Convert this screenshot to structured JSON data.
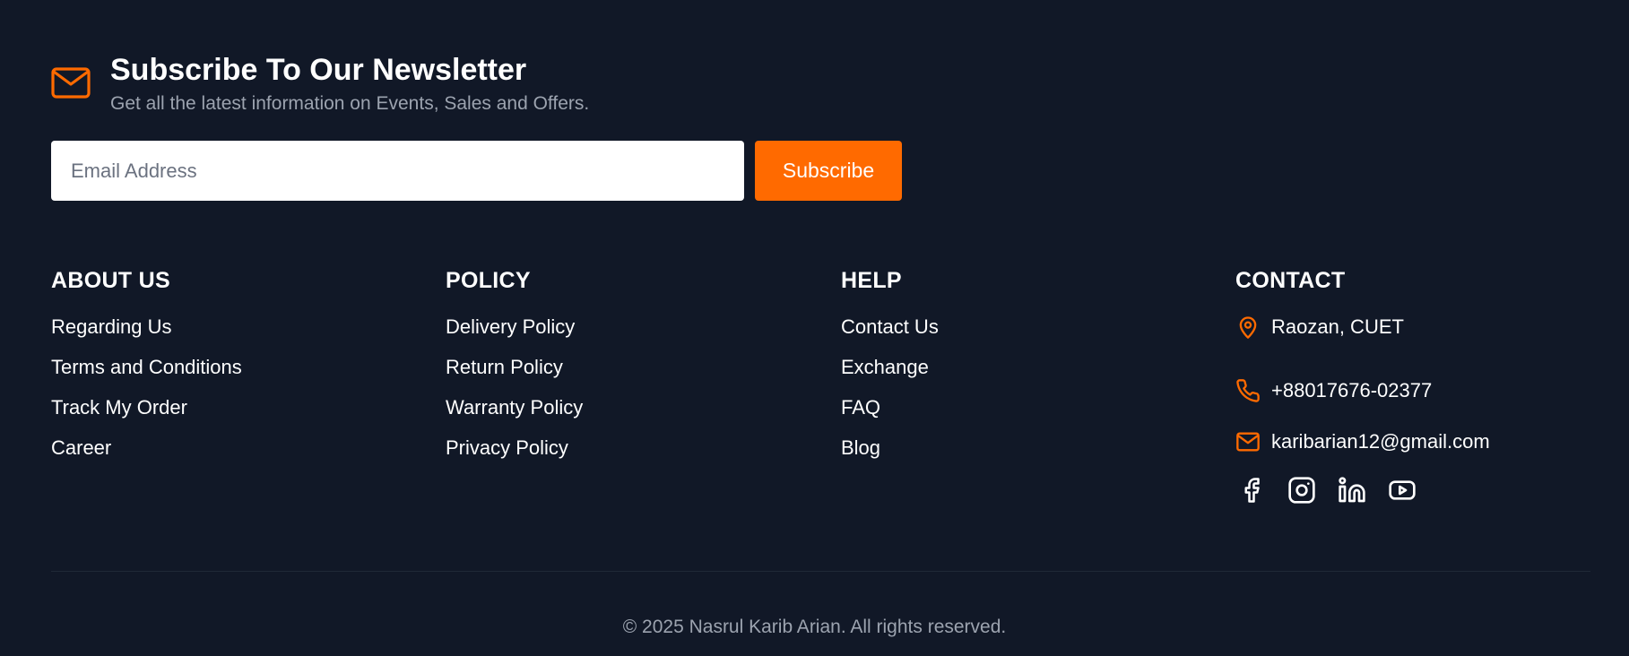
{
  "newsletter": {
    "title": "Subscribe To Our Newsletter",
    "subtitle": "Get all the latest information on Events, Sales and Offers.",
    "email_placeholder": "Email Address",
    "email_value": "",
    "button_label": "Subscribe",
    "icon": "mail-icon"
  },
  "columns": {
    "about": {
      "title": "ABOUT US",
      "links": [
        "Regarding Us",
        "Terms and Conditions",
        "Track My Order",
        "Career"
      ]
    },
    "policy": {
      "title": "POLICY",
      "links": [
        "Delivery Policy",
        "Return Policy",
        "Warranty Policy",
        "Privacy Policy"
      ]
    },
    "help": {
      "title": "HELP",
      "links": [
        "Contact Us",
        "Exchange",
        "FAQ",
        "Blog"
      ]
    },
    "contact": {
      "title": "CONTACT",
      "items": [
        {
          "icon": "map-pin-icon",
          "text": "Raozan, CUET"
        },
        {
          "icon": "phone-icon",
          "text": "+88017676-02377"
        },
        {
          "icon": "mail-icon",
          "text": "karibarian12@gmail.com"
        }
      ],
      "socials": [
        "facebook-icon",
        "instagram-icon",
        "linkedin-icon",
        "youtube-icon"
      ]
    }
  },
  "copyright": "© 2025 Nasrul Karib Arian. All rights reserved.",
  "colors": {
    "background": "#111827",
    "accent": "#ff6a00",
    "muted_text": "#9ca3af",
    "text": "#ffffff"
  }
}
